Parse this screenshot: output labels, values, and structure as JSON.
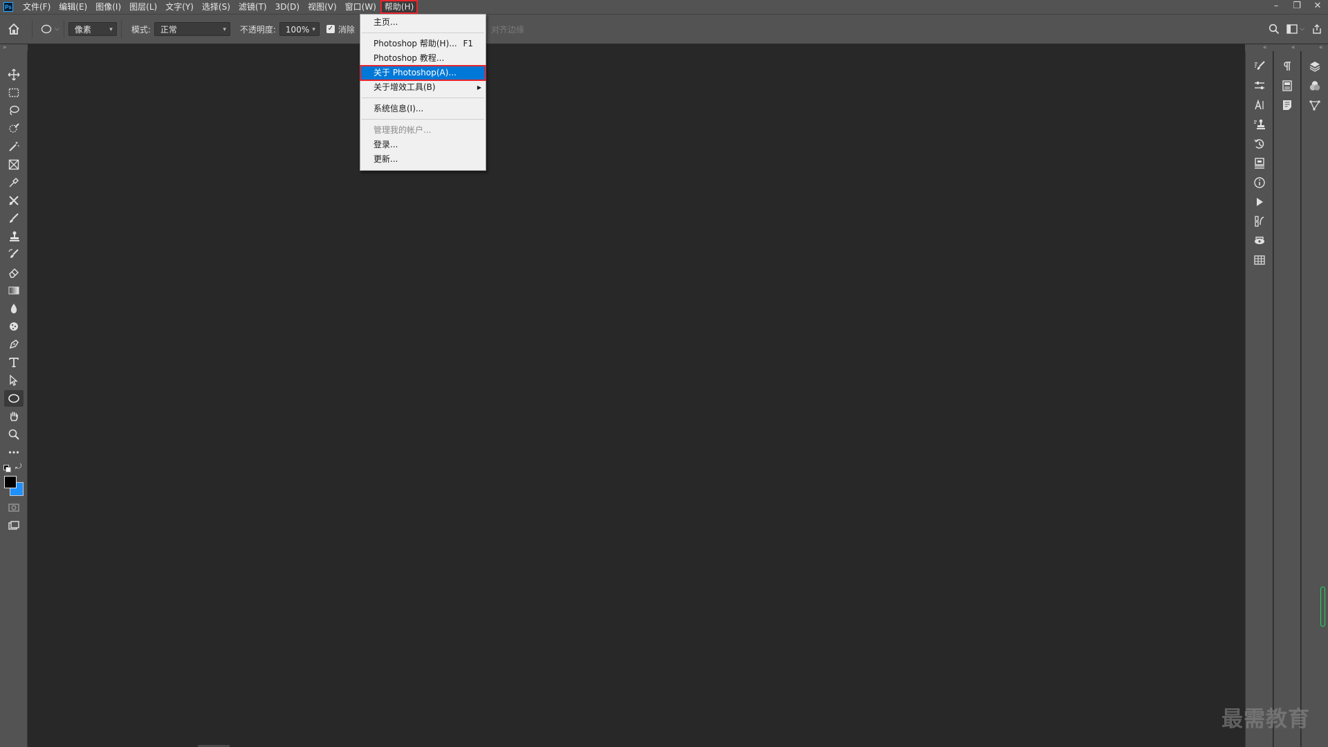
{
  "app": {
    "logo_text": "Ps"
  },
  "menubar": {
    "items": [
      "文件(F)",
      "编辑(E)",
      "图像(I)",
      "图层(L)",
      "文字(Y)",
      "选择(S)",
      "滤镜(T)",
      "3D(D)",
      "视图(V)",
      "窗口(W)",
      "帮助(H)"
    ],
    "active_index": 10,
    "window_controls": [
      "–",
      "❐",
      "✕"
    ]
  },
  "options": {
    "fill_type": "像素",
    "mode_label": "模式:",
    "mode_value": "正常",
    "opacity_label": "不透明度:",
    "opacity_value": "100%",
    "antialias_label": "消除",
    "antialias_checked": true,
    "align_edges_label": "对齐边缘"
  },
  "help_menu": {
    "items": [
      {
        "label": "主页...",
        "shortcut": "",
        "state": "normal"
      },
      {
        "label": "Photoshop 帮助(H)...",
        "shortcut": "F1",
        "state": "normal"
      },
      {
        "label": "Photoshop 教程...",
        "shortcut": "",
        "state": "normal"
      },
      {
        "label": "关于 Photoshop(A)...",
        "shortcut": "",
        "state": "highlighted"
      },
      {
        "label": "关于增效工具(B)",
        "shortcut": "",
        "state": "submenu"
      },
      {
        "label": "系统信息(I)...",
        "shortcut": "",
        "state": "normal"
      },
      {
        "label": "管理我的帐户...",
        "shortcut": "",
        "state": "disabled"
      },
      {
        "label": "登录...",
        "shortcut": "",
        "state": "normal"
      },
      {
        "label": "更新...",
        "shortcut": "",
        "state": "normal"
      }
    ]
  },
  "toolbar": {
    "tools": [
      "move-tool",
      "marquee-tool",
      "lasso-tool",
      "quick-select-tool",
      "crop-tool",
      "frame-tool",
      "eyedropper-tool",
      "patch-tool",
      "brush-tool",
      "clone-stamp-tool",
      "history-brush-tool",
      "eraser-tool",
      "gradient-tool",
      "blur-tool",
      "dodge-tool",
      "pen-tool",
      "type-tool",
      "path-select-tool",
      "ellipse-tool",
      "hand-tool",
      "zoom-tool",
      "more-tools"
    ],
    "active_tool": "ellipse-tool",
    "foreground_color": "#000000",
    "background_color": "#1e90ff"
  },
  "dock": {
    "col1": [
      "brush-settings-icon",
      "adjustments-icon",
      "character-icon",
      "clone-source-icon",
      "history-icon",
      "properties-icon",
      "info-icon",
      "actions-icon",
      "tool-presets-icon",
      "3d-icon",
      "table-icon"
    ],
    "col2": [
      "paragraph-icon",
      "glyphs-icon",
      "notes-icon"
    ],
    "col3": [
      "layers-icon",
      "channels-icon",
      "paths-icon"
    ]
  },
  "watermark": "最需教育",
  "colors": {
    "highlight": "#0078d7",
    "annotation_red": "#e8252b",
    "chrome": "#535353",
    "canvas": "#282828"
  }
}
